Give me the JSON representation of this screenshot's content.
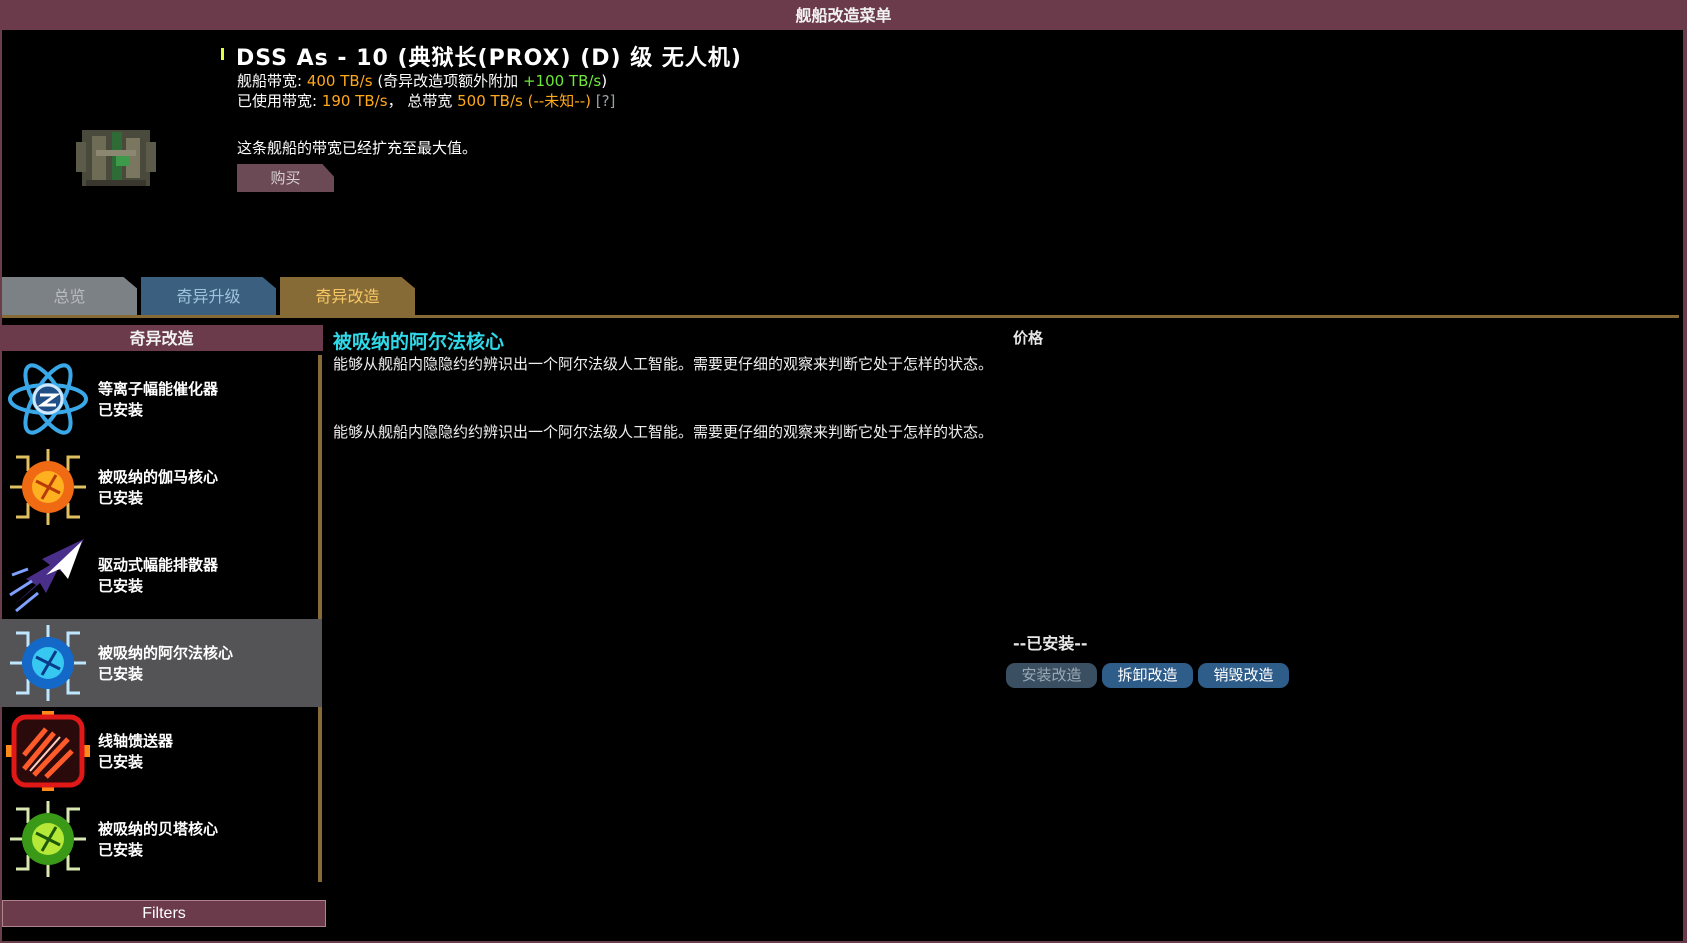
{
  "window": {
    "title": "舰船改造菜单"
  },
  "ship": {
    "name": "DSS As - 10 (典狱长(PROX) (D) 级 无人机)",
    "bandwidth_label": "舰船带宽: ",
    "bandwidth_value": "400 TB/s",
    "bandwidth_extra_pre": " (奇异改造项额外附加 ",
    "bandwidth_extra_value": "+100 TB/s",
    "bandwidth_extra_post": ")",
    "used_label": "已使用带宽: ",
    "used_value": "190 TB/s",
    "total_label": "，  总带宽 ",
    "total_value": "500 TB/s (--未知--)",
    "help": " [?]",
    "maxed_note": "这条舰船的带宽已经扩充至最大值。",
    "buy_label": "购买"
  },
  "tabs": [
    {
      "label": "总览"
    },
    {
      "label": "奇异升级"
    },
    {
      "label": "奇异改造"
    }
  ],
  "list": {
    "header": "奇异改造",
    "items": [
      {
        "name": "等离子幅能催化器",
        "status": "已安装",
        "icon": "atom-icon"
      },
      {
        "name": "被吸纳的伽马核心",
        "status": "已安装",
        "icon": "gamma-core-icon"
      },
      {
        "name": "驱动式幅能排散器",
        "status": "已安装",
        "icon": "flux-vent-icon"
      },
      {
        "name": "被吸纳的阿尔法核心",
        "status": "已安装",
        "icon": "alpha-core-icon"
      },
      {
        "name": "线轴馈送器",
        "status": "已安装",
        "icon": "feeder-icon"
      },
      {
        "name": "被吸纳的贝塔核心",
        "status": "已安装",
        "icon": "beta-core-icon"
      }
    ],
    "filters_label": "Filters"
  },
  "detail": {
    "title": "被吸纳的阿尔法核心",
    "desc1": "能够从舰船内隐隐约约辨识出一个阿尔法级人工智能。需要更仔细的观察来判断它处于怎样的状态。",
    "desc2": "能够从舰船内隐隐约约辨识出一个阿尔法级人工智能。需要更仔细的观察来判断它处于怎样的状态。",
    "price_label": "价格",
    "installed_label": "--已安装--",
    "install_btn": "安装改造",
    "remove_btn": "拆卸改造",
    "destroy_btn": "销毁改造"
  },
  "colors": {
    "title_bar": "#6b3b4b",
    "accent_cyan": "#2fd9e8",
    "orange": "#ffa81a",
    "green": "#6ee83a",
    "tab_active": "#876b36"
  }
}
